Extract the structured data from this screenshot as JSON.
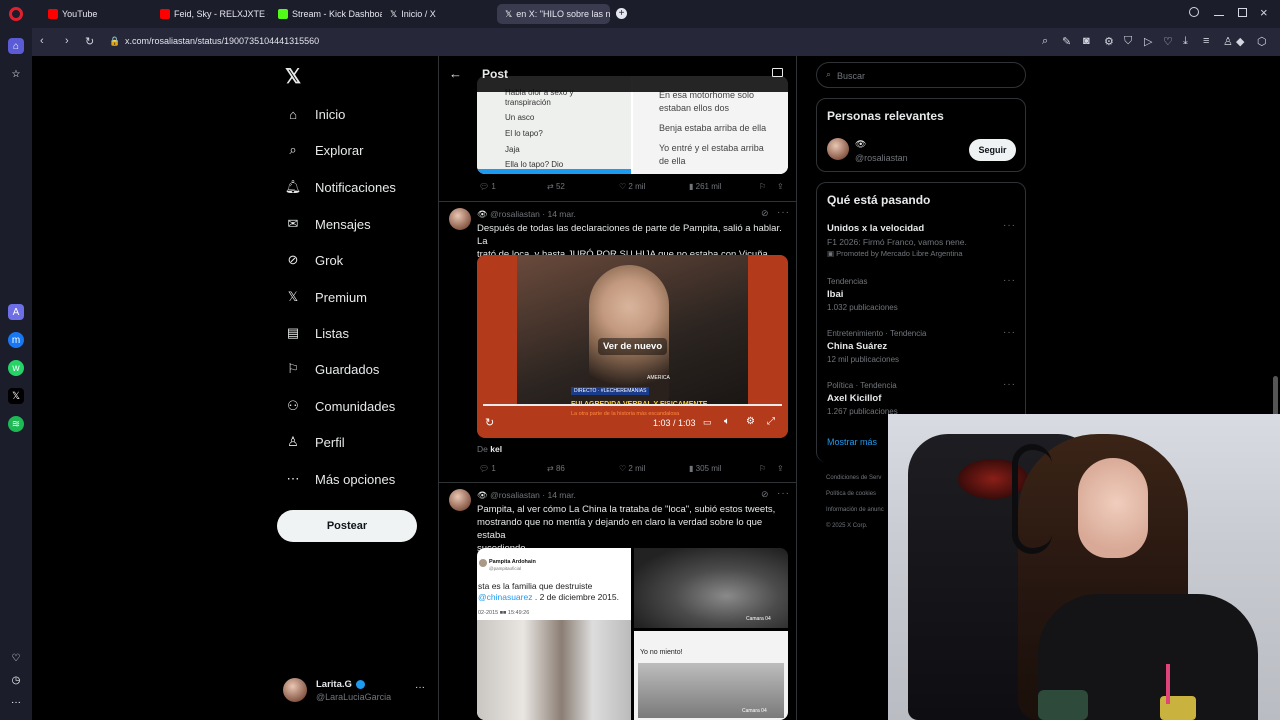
{
  "browser": {
    "tabs": [
      {
        "label": "YouTube"
      },
      {
        "label": "Feid, Sky - RELXJXTE - You"
      },
      {
        "label": "Stream - Kick Dashboard"
      },
      {
        "label": "Inicio / X"
      },
      {
        "label": "en X: \"HILO sobre las n"
      }
    ],
    "url": "x.com/rosaliastan/status/1900735104441315560"
  },
  "nav": {
    "items": [
      "Inicio",
      "Explorar",
      "Notificaciones",
      "Mensajes",
      "Grok",
      "Premium",
      "Listas",
      "Guardados",
      "Comunidades",
      "Perfil",
      "Más opciones"
    ],
    "post_button": "Postear",
    "account_name": "Larita.G",
    "account_handle": "@LaraLuciaGarcia"
  },
  "main": {
    "header_title": "Post",
    "top_media": {
      "left_lines": [
        "Habla olor a sexo y",
        "transpiración",
        "Un asco",
        "El lo tapo?",
        "Jaja",
        "Ella lo tapo? Dio"
      ],
      "right_lines": [
        "En esa motorhome solo",
        "estaban ellos dos",
        "Benja estaba arriba de ella",
        "Yo entré y el estaba arriba",
        "de ella"
      ]
    },
    "top_actions": {
      "replies": "1",
      "reposts": "52",
      "likes": "2 mil",
      "views": "261 mil"
    },
    "tweet1": {
      "handle": "@rosaliastan",
      "date": "· 14 mar.",
      "text_lines": [
        "Después de todas las declaraciones de parte de Pampita, salió a hablar. La",
        "trató de loca, y hasta JURÓ POR SU HIJA que no estaba con Vicuña."
      ],
      "video_overlay": "Ver de nuevo",
      "video_time": "1:03 / 1:03",
      "video_caption": "FUI AGREDIDA VERBAL Y FISICAMENTE",
      "video_subcaption": "La otra parte de la historia más escandalosa",
      "video_live": "DIRECTO · #LECHEREMANIAS",
      "video_channel": "AMERICA",
      "from_label": "De",
      "from_user": "kel",
      "actions": {
        "replies": "1",
        "reposts": "86",
        "likes": "2 mil",
        "views": "305 mil"
      }
    },
    "tweet2": {
      "handle": "@rosaliastan",
      "date": "· 14 mar.",
      "text_lines": [
        "Pampita, al ver cómo La China la trataba de \"loca\", subió estos tweets,",
        "mostrando que no mentía y dejando en claro la verdad sobre lo que estaba",
        "sucediendo."
      ],
      "media_name": "Pampita Ardohain",
      "media_handle": "@pampitaoficial",
      "media_text1": "sta es la familia que destruiste",
      "media_mention": "@chinasuarez",
      "media_date": ". 2 de diciembre 2015.",
      "media_timestamp": "02-2015 ■■ 15:49:26",
      "media_cam": "Camara 04",
      "media_cam2": "Camara 04",
      "media_quote": "Yo no miento!"
    }
  },
  "right": {
    "search_placeholder": "Buscar",
    "relevant_title": "Personas relevantes",
    "relevant_handle": "@rosaliastan",
    "follow_label": "Seguir",
    "trending_title": "Qué está pasando",
    "trends": [
      {
        "title": "Unidos x la velocidad",
        "sub": "F1 2026: Firmó Franco, vamos nene.",
        "promo": "Promoted by Mercado Libre Argentina"
      },
      {
        "category": "Tendencias",
        "title": "Ibai",
        "count": "1.032 publicaciones"
      },
      {
        "category": "Entretenimiento · Tendencia",
        "title": "China Suárez",
        "count": "12 mil publicaciones"
      },
      {
        "category": "Política · Tendencia",
        "title": "Axel Kicillof",
        "count": "1.267 publicaciones"
      }
    ],
    "show_more": "Mostrar más",
    "footer": [
      "Condiciones de Serv",
      "Política de cookies",
      "Información de anunc",
      "© 2025 X Corp."
    ]
  },
  "colors": {
    "background": "#000000",
    "browser_chrome": "#1c1d2b",
    "accent_link": "#1d9bf0",
    "text_secondary": "#71767b",
    "border": "#2f3336"
  }
}
